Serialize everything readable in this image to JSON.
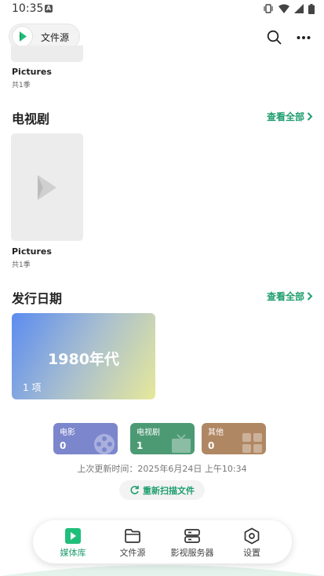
{
  "status_bar": {
    "time": "10:35",
    "notif_letter": "A"
  },
  "top_bar": {
    "source_label": "文件源"
  },
  "top_card": {
    "title": "Pictures",
    "subtitle": "共1季"
  },
  "tv_section": {
    "title": "电视剧",
    "see_all": "查看全部",
    "card": {
      "title": "Pictures",
      "subtitle": "共1季"
    }
  },
  "release_section": {
    "title": "发行日期",
    "see_all": "查看全部",
    "card": {
      "title": "1980年代",
      "count": "1 项"
    }
  },
  "stats": [
    {
      "label": "电影",
      "value": "0",
      "color": "#7b86cc"
    },
    {
      "label": "电视剧",
      "value": "1",
      "color": "#4c9a74"
    },
    {
      "label": "其他",
      "value": "0",
      "color": "#b08763"
    }
  ],
  "last_update": "上次更新时间：2025年6月24日 上午10:34",
  "rescan_label": "重新扫描文件",
  "bottom_nav": [
    {
      "label": "媒体库",
      "icon": "media-library-icon",
      "active": true
    },
    {
      "label": "文件源",
      "icon": "folder-icon",
      "active": false
    },
    {
      "label": "影视服务器",
      "icon": "server-icon",
      "active": false
    },
    {
      "label": "设置",
      "icon": "settings-icon",
      "active": false
    }
  ],
  "accent_color": "#1e9e6e"
}
